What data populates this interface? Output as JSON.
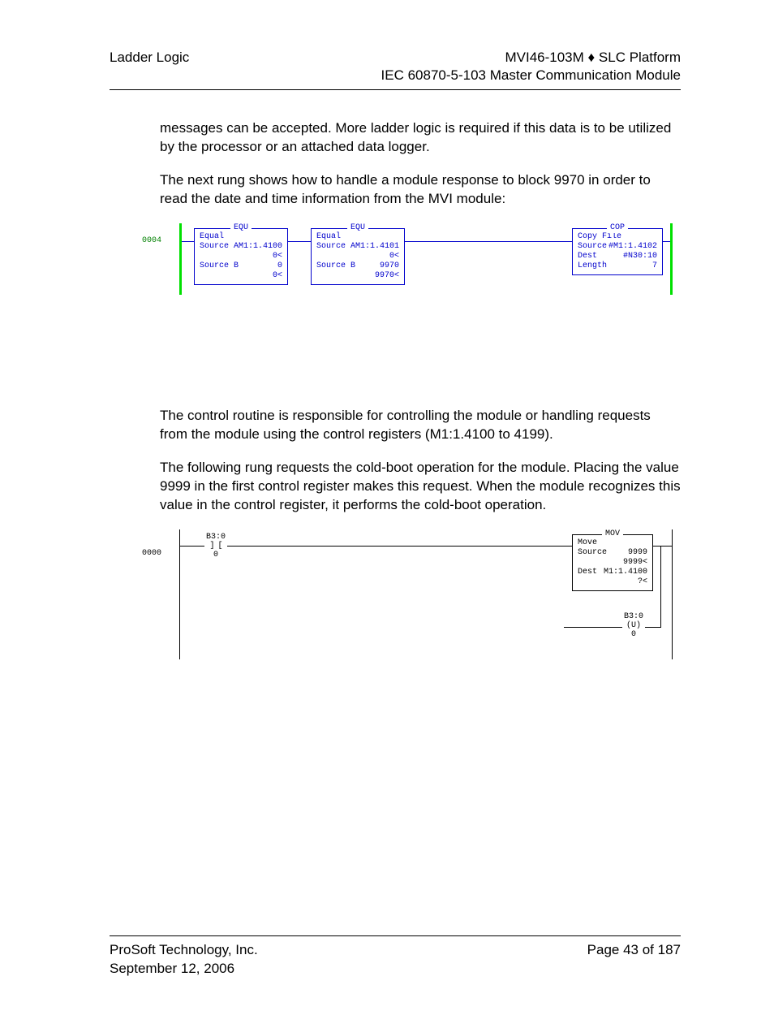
{
  "header": {
    "left": "Ladder Logic",
    "right1": "MVI46-103M ♦ SLC Platform",
    "right2": "IEC 60870-5-103 Master Communication Module"
  },
  "para1": "messages can be accepted. More ladder logic is required if this data is to be utilized by the processor or an attached data logger.",
  "para2": "The next rung shows how to handle a module response to block 9970 in order to read the date and time information from the MVI module:",
  "rung1": {
    "num": "0004",
    "equ1": {
      "mnemonic": "EQU",
      "name": "Equal",
      "srcA_label": "Source A",
      "srcA_val": "M1:1.4100",
      "srcA_v2": "0<",
      "srcB_label": "Source B",
      "srcB_val": "0",
      "srcB_v2": "0<"
    },
    "equ2": {
      "mnemonic": "EQU",
      "name": "Equal",
      "srcA_label": "Source A",
      "srcA_val": "M1:1.4101",
      "srcA_v2": "0<",
      "srcB_label": "Source B",
      "srcB_val": "9970",
      "srcB_v2": "9970<"
    },
    "cop": {
      "mnemonic": "COP",
      "name": "Copy File",
      "src_label": "Source",
      "src_val": "#M1:1.4102",
      "dst_label": "Dest",
      "dst_val": "#N30:10",
      "len_label": "Length",
      "len_val": "7"
    }
  },
  "para3": "The control routine is responsible for controlling the module or handling requests from the module using the control registers (M1:1.4100 to 4199).",
  "para4": "The following rung requests the cold-boot operation for the module. Placing the value 9999 in the first control register makes this request. When the module recognizes this value in the control register, it performs the cold-boot operation.",
  "rung2": {
    "num": "0000",
    "contact_addr": "B3:0",
    "contact_bit": "0",
    "mov": {
      "mnemonic": "MOV",
      "name": "Move",
      "src_label": "Source",
      "src_val": "9999",
      "src_v2": "9999<",
      "dst_label": "Dest",
      "dst_val": "M1:1.4100",
      "dst_v2": "?<"
    },
    "unlatch_addr": "B3:0",
    "unlatch_sym": "(U)",
    "unlatch_bit": "0"
  },
  "footer": {
    "company": "ProSoft Technology, Inc.",
    "date": "September 12, 2006",
    "page": "Page 43 of 187"
  }
}
